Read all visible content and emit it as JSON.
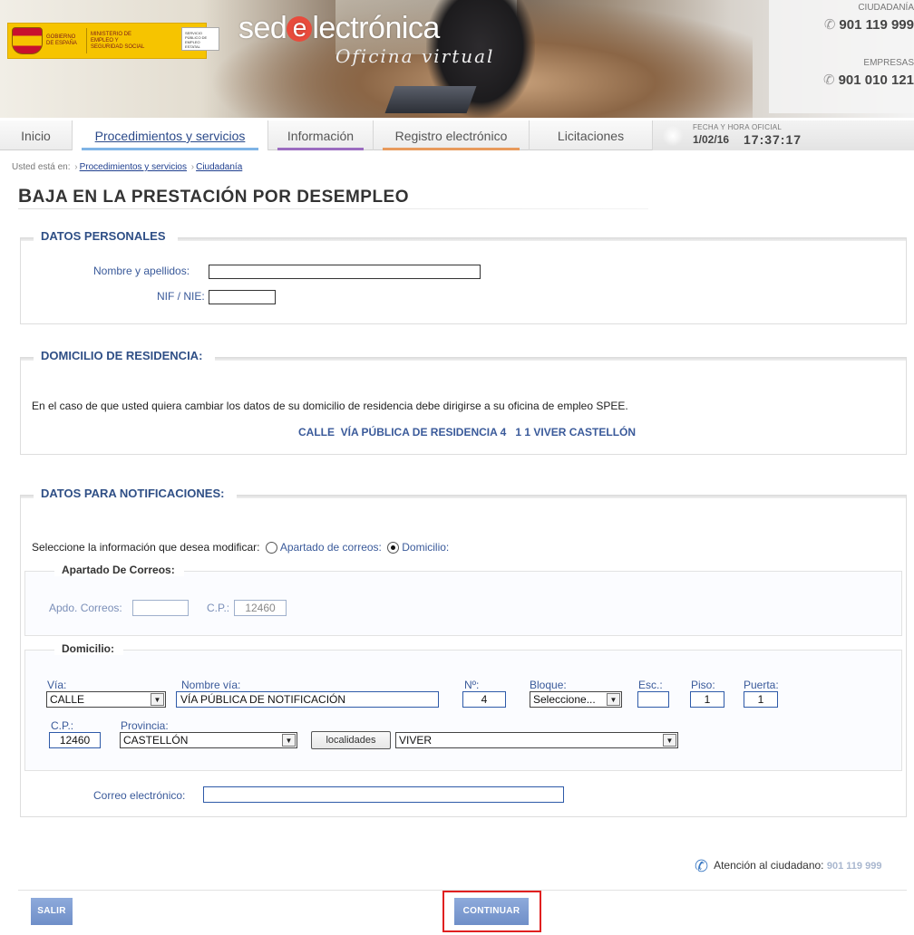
{
  "header": {
    "gobierno": "GOBIERNO DE ESPAÑA",
    "ministerio": "MINISTERIO DE EMPLEO Y SEGURIDAD SOCIAL",
    "spee": "SERVICIO PÚBLICO DE EMPLEO ESTATAL",
    "site_name_pre": "sed",
    "site_name_e": "e",
    "site_name_post": "lectrónica",
    "site_sub": "Oficina virtual",
    "ciudadania_label": "CIUDADANÍA",
    "ciudadania_phone": "901 119 999",
    "empresas_label": "EMPRESAS",
    "empresas_phone": "901 010 121"
  },
  "nav": {
    "tabs": [
      "Inicio",
      "Procedimientos y servicios",
      "Información",
      "Registro electrónico",
      "Licitaciones"
    ],
    "datetime_label": "FECHA Y HORA OFICIAL",
    "date": "1/02/16",
    "time": "17:37:17"
  },
  "breadcrumb": {
    "prefix": "Usted está en:",
    "items": [
      "Procedimientos y servicios",
      "Ciudadanía"
    ]
  },
  "title": {
    "first": "B",
    "rest": "AJA EN LA PRESTACIÓN POR DESEMPLEO"
  },
  "personal": {
    "legend": "DATOS PERSONALES",
    "name_label": "Nombre y apellidos:",
    "nif_label": "NIF / NIE:"
  },
  "domicilio_res": {
    "legend": "DOMICILIO DE RESIDENCIA:",
    "note": "En el caso de que usted quiera cambiar los datos de su domicilio de residencia debe dirigirse a su oficina de empleo SPEE.",
    "address": "CALLE  VÍA PÚBLICA DE RESIDENCIA 4   1 1 VIVER CASTELLÓN"
  },
  "notificaciones": {
    "legend": "DATOS PARA NOTIFICACIONES:",
    "select_prompt": "Seleccione la información que desea modificar:",
    "option_apartado": "Apartado de correos:",
    "option_domicilio": "Domicilio:",
    "apartado": {
      "legend": "Apartado De Correos:",
      "apdo_label": "Apdo. Correos:",
      "apdo_value": "",
      "cp_label": "C.P.:",
      "cp_value": "12460"
    },
    "domicilio": {
      "legend": "Domicilio:",
      "via_label": "Vía:",
      "via_value": "CALLE",
      "nombre_via_label": "Nombre vía:",
      "nombre_via_value": "VÍA PÚBLICA DE NOTIFICACIÓN",
      "num_label": "Nº:",
      "num_value": "4",
      "bloque_label": "Bloque:",
      "bloque_value": "Seleccione...",
      "esc_label": "Esc.:",
      "esc_value": "",
      "piso_label": "Piso:",
      "piso_value": "1",
      "puerta_label": "Puerta:",
      "puerta_value": "1",
      "cp_label": "C.P.:",
      "cp_value": "12460",
      "provincia_label": "Provincia:",
      "provincia_value": "CASTELLÓN",
      "localidades_button": "localidades",
      "localidad_value": "VIVER"
    },
    "email_label": "Correo electrónico:",
    "email_value": ""
  },
  "footer": {
    "atencion_label": "Atención al ciudadano:",
    "atencion_phone": "901 119 999",
    "salir": "SALIR",
    "continuar": "CONTINUAR"
  },
  "colors": {
    "accent": "#2f4f86",
    "button": "#7f9bd0",
    "highlight_border": "#e02020"
  }
}
